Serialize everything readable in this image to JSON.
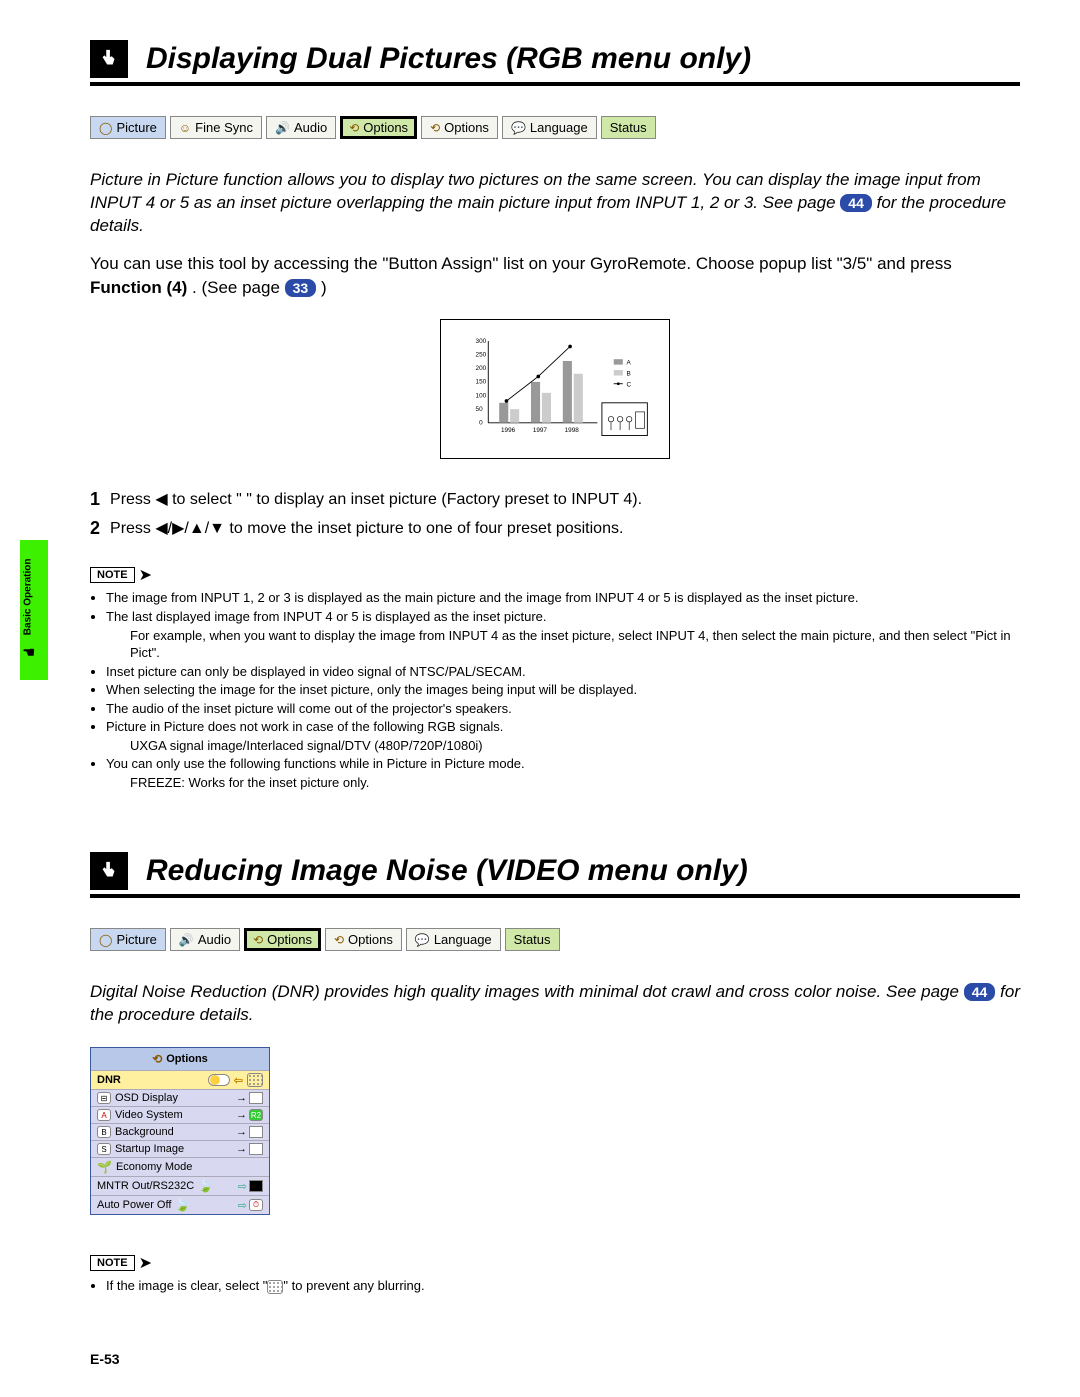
{
  "side_tab": "Basic Operation",
  "section1": {
    "title": "Displaying Dual Pictures (RGB menu only)",
    "menu": [
      "Picture",
      "Fine Sync",
      "Audio",
      "Options",
      "Options",
      "Language",
      "Status"
    ],
    "intro_a": "Picture in Picture function allows you to display two pictures on the same screen. You can display the image input from INPUT 4 or 5 as an inset picture overlapping the main picture input from INPUT 1, 2 or 3. See page ",
    "intro_page": "44",
    "intro_b": " for the procedure details.",
    "body_a": "You can use this tool by accessing the \"Button Assign\" list on your GyroRemote. Choose popup list \"3/5\" and press ",
    "body_bold": "Function (4)",
    "body_b": ". (See page ",
    "body_page": "33",
    "body_c": " )",
    "step1": "Press ◀ to select \"   \" to display an inset picture (Factory preset to INPUT 4).",
    "step2": "Press ◀/▶/▲/▼ to move the inset picture to one of four preset positions.",
    "note_label": "NOTE",
    "notes": [
      "The image from INPUT 1, 2 or 3 is displayed as the main picture and the image from INPUT 4 or 5 is displayed as the inset picture.",
      "The last displayed image from INPUT 4 or 5 is displayed as the inset picture.",
      "For example, when you want to display the image from INPUT 4 as the inset picture, select INPUT 4, then select the main picture, and then select \"Pict in Pict\".",
      "Inset picture can only be displayed in video signal of NTSC/PAL/SECAM.",
      "When selecting the image for the inset picture, only the images being input will be displayed.",
      "The audio of the inset picture will come out of the projector's speakers.",
      "Picture in Picture does not work in case of the following RGB signals.",
      "UXGA signal image/Interlaced signal/DTV (480P/720P/1080i)",
      "You can only use the following functions while in Picture in Picture mode.",
      "FREEZE: Works for the inset picture only."
    ]
  },
  "section2": {
    "title": "Reducing Image Noise (VIDEO menu only)",
    "menu": [
      "Picture",
      "Audio",
      "Options",
      "Options",
      "Language",
      "Status"
    ],
    "intro_a": "Digital Noise Reduction (DNR) provides high quality images with minimal dot crawl and cross color noise. See page ",
    "intro_page": "44",
    "intro_b": " for the procedure details.",
    "panel_header": "Options",
    "panel_rows": [
      {
        "label": "DNR",
        "type": "toggle-dotted"
      },
      {
        "label": "OSD Display",
        "icon": "⊟",
        "type": "arrow-sq"
      },
      {
        "label": "Video System",
        "icon": "A",
        "type": "arrow-green"
      },
      {
        "label": "Background",
        "icon": "B",
        "type": "arrow-sq"
      },
      {
        "label": "Startup Image",
        "icon": "S",
        "type": "arrow-sq"
      },
      {
        "label": "Economy Mode",
        "icon": "🌱",
        "type": "none"
      },
      {
        "label": "MNTR Out/RS232C",
        "icon": "",
        "type": "leaf-sq"
      },
      {
        "label": "Auto Power Off",
        "icon": "",
        "type": "leaf-clock"
      }
    ],
    "note_label": "NOTE",
    "note_text": "If the image is clear, select \"⊘\" to prevent any blurring."
  },
  "chart_data": {
    "type": "bar",
    "categories": [
      "1996",
      "1997",
      "1998"
    ],
    "series": [
      {
        "name": "A",
        "values": [
          75,
          150,
          225
        ]
      },
      {
        "name": "B",
        "values": [
          50,
          110,
          180
        ]
      }
    ],
    "line_series": {
      "name": "C",
      "x": [
        "1996",
        "1997",
        "1998"
      ],
      "y": [
        80,
        170,
        280
      ]
    },
    "ylim": [
      0,
      300
    ],
    "yticks": [
      0,
      50,
      100,
      150,
      200,
      250,
      300
    ],
    "title": "",
    "xlabel": "",
    "ylabel": ""
  },
  "page_number": "E-53"
}
